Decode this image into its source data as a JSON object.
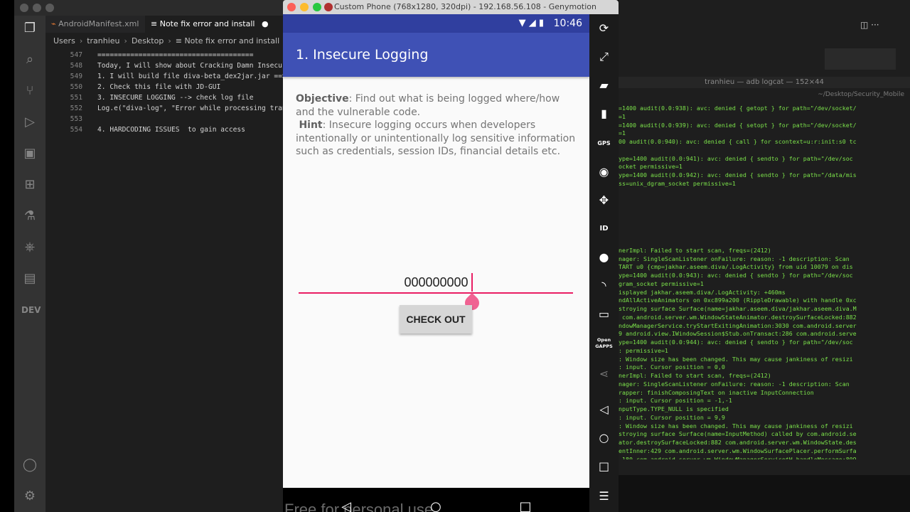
{
  "vscode": {
    "tabs": [
      {
        "label": "AndroidManifest.xml",
        "icon": "rss-icon"
      },
      {
        "label": "Note fix error and install",
        "icon": "list-icon",
        "modified_dot": "●"
      }
    ],
    "breadcrumb": [
      "Users",
      "tranhieu",
      "Desktop",
      "Note fix error and install"
    ],
    "lines": [
      {
        "num": "547",
        "text": "======================================"
      },
      {
        "num": "548",
        "text": "Today, I will show about Cracking Damn Insecur"
      },
      {
        "num": "549",
        "text": "1. I will build file diva-beta_dex2jar.jar ==>"
      },
      {
        "num": "550",
        "text": "2. Check this file with JD-GUI"
      },
      {
        "num": "551",
        "text": "3. INSECURE LOGGING --> check log file"
      },
      {
        "num": "552",
        "text": "Log.e(\"diva-log\", \"Error while processing tran"
      },
      {
        "num": "553",
        "text": ""
      },
      {
        "num": "554",
        "text": "4. HARDCODING ISSUES  to gain access"
      }
    ],
    "activity_dev_label": "DEV"
  },
  "genymotion": {
    "window_title": "Custom Phone (768x1280, 320dpi) - 192.168.56.108 - Genymotion",
    "status_time": "10:46",
    "app_title": "1. Insecure Logging",
    "objective_label": "Objective",
    "objective_text": ": Find out what is being logged where/how and the vulnerable code.",
    "hint_label": "Hint",
    "hint_text": ": Insecure logging occurs when developers intentionally or unintentionally log sensitive information such as credentials, session IDs, financial details etc.",
    "input_value": "000000000",
    "button_label": "CHECK OUT",
    "watermark": "Free for personal use",
    "toolbar": {
      "gps_label": "GPS",
      "id_label": "ID",
      "opengapps_label": "Open GAPPS"
    }
  },
  "terminal": {
    "title": "tranhieu — adb logcat — 152×44",
    "path": "~/Desktop/Security_Mobile",
    "lines": [
      "=1400 audit(0.0:938): avc: denied { getopt } for path=\"/dev/socket/",
      "=1",
      "=1400 audit(0.0:939): avc: denied { setopt } for path=\"/dev/socket/",
      "=1",
      "00 audit(0.0:940): avc: denied { call } for scontext=u:r:init:s0 tc",
      "",
      "ype=1400 audit(0.0:941): avc: denied { sendto } for path=\"/dev/soc",
      "ocket permissive=1",
      "ype=1400 audit(0.0:942): avc: denied { sendto } for path=\"/data/mis",
      "ss=unix_dgram_socket permissive=1",
      "",
      "",
      "",
      "",
      "",
      "",
      "",
      "nerImpl: Failed to start scan, freqs=(2412)",
      "nager: SingleScanListener onFailure: reason: -1 description: Scan",
      "TART u0 {cmp=jakhar.aseem.diva/.LogActivity} from uid 10079 on dis",
      "ype=1400 audit(0.0:943): avc: denied { sendto } for path=\"/dev/soc",
      "gram_socket permissive=1",
      "isplayed jakhar.aseem.diva/.LogActivity: +460ms",
      "ndAllActiveAnimators on 0xc899a200 (RippleDrawable) with handle 0xc",
      "stroying surface Surface(name=jakhar.aseem.diva/jakhar.aseem.diva.M",
      " com.android.server.wm.WindowStateAnimator.destroySurfaceLocked:882",
      "ndowManagerService.tryStartExitingAnimation:3030 com.android.server",
      "9 android.view.IWindowSession$Stub.onTransact:286 com.android.serve",
      "ype=1400 audit(0.0:944): avc: denied { sendto } for path=\"/dev/soc",
      ": permissive=1",
      ": Window size has been changed. This may cause jankiness of resizi",
      ": input. Cursor position = 0,0",
      "nerImpl: Failed to start scan, freqs=(2412)",
      "nager: SingleScanListener onFailure: reason: -1 description: Scan",
      "rapper: finishComposingText on inactive InputConnection",
      ": input. Cursor position = -1,-1",
      "nputType.TYPE_NULL is specified",
      ": input. Cursor position = 9,9",
      ": Window size has been changed. This may cause jankiness of resizi",
      "stroying surface Surface(name=InputMethod) called by com.android.se",
      "ator.destroySurfaceLocked:882 com.android.server.wm.WindowState.des",
      "entInner:429 com.android.server.wm.WindowSurfacePlacer.performSurfa",
      " 180 com.android.server.wm.WindowManagerService$H.handleMessage:809"
    ]
  }
}
